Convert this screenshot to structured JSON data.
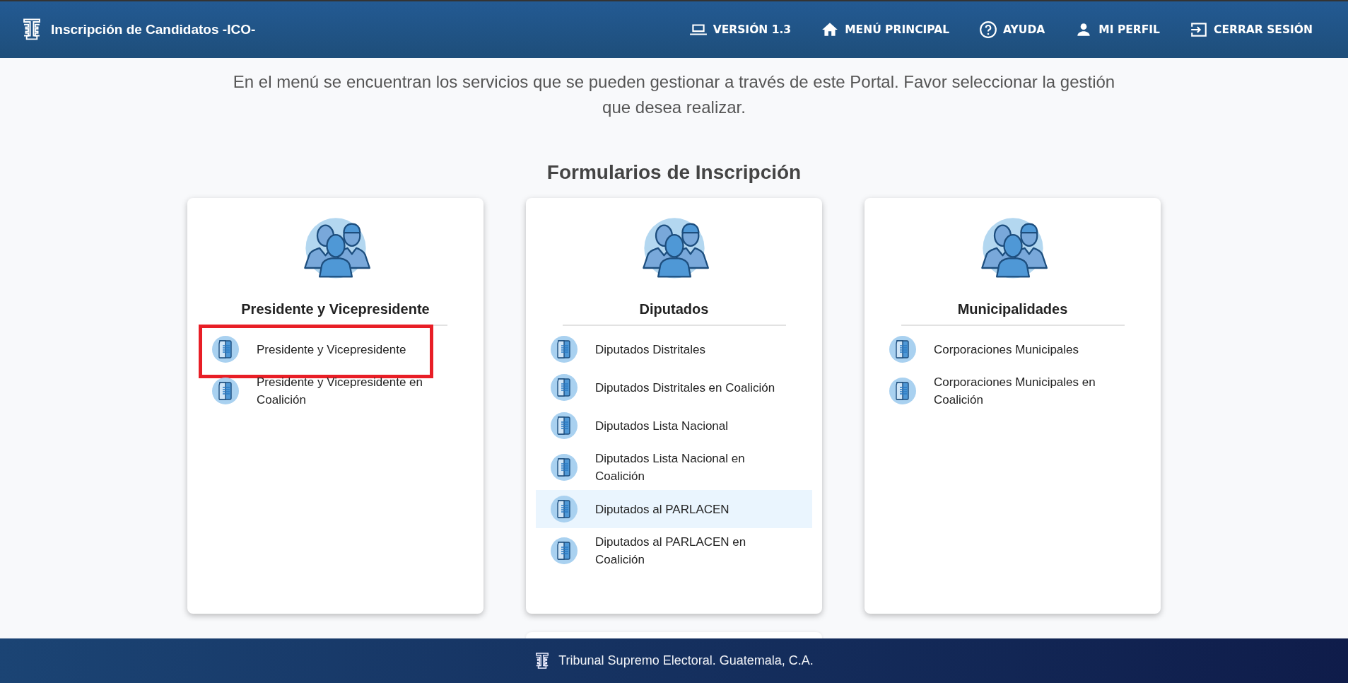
{
  "header": {
    "title": "Inscripción de Candidatos -ICO-",
    "nav": [
      {
        "kind": "laptop",
        "label": "VERSIÓN 1.3"
      },
      {
        "kind": "home",
        "label": "MENÚ PRINCIPAL"
      },
      {
        "kind": "help",
        "label": "AYUDA"
      },
      {
        "kind": "person",
        "label": "MI PERFIL"
      },
      {
        "kind": "logout",
        "label": "CERRAR SESIÓN"
      }
    ]
  },
  "intro": "En el menú se encuentran los servicios que se pueden gestionar a través de este Portal. Favor seleccionar la gestión que desea realizar.",
  "section_title": "Formularios de Inscripción",
  "cards": [
    {
      "title": "Presidente y Vicepresidente",
      "items": [
        {
          "label": "Presidente y Vicepresidente",
          "highlighted": false,
          "marked": true
        },
        {
          "label": "Presidente y Vicepresidente en Coalición",
          "highlighted": false,
          "marked": false
        }
      ]
    },
    {
      "title": "Diputados",
      "items": [
        {
          "label": "Diputados Distritales",
          "highlighted": false,
          "marked": false
        },
        {
          "label": "Diputados Distritales en Coalición",
          "highlighted": false,
          "marked": false
        },
        {
          "label": "Diputados Lista Nacional",
          "highlighted": false,
          "marked": false
        },
        {
          "label": "Diputados Lista Nacional en Coalición",
          "highlighted": false,
          "marked": false
        },
        {
          "label": "Diputados al PARLACEN",
          "highlighted": true,
          "marked": false
        },
        {
          "label": "Diputados al PARLACEN en Coalición",
          "highlighted": false,
          "marked": false
        }
      ]
    },
    {
      "title": "Municipalidades",
      "items": [
        {
          "label": "Corporaciones Municipales",
          "highlighted": false,
          "marked": false
        },
        {
          "label": "Corporaciones Municipales en Coalición",
          "highlighted": false,
          "marked": false
        }
      ]
    }
  ],
  "footer": {
    "text": "Tribunal Supremo Electoral. Guatemala, C.A."
  }
}
